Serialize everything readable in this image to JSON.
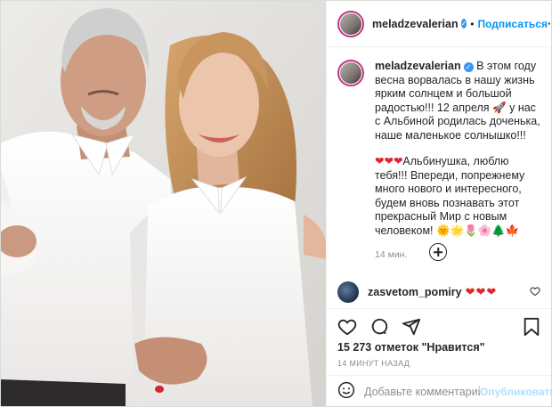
{
  "post": {
    "username": "meladzevalerian",
    "follow_label": "Подписаться",
    "more_label": "···",
    "caption": {
      "line1": "В этом году весна ворвалась в нашу жизнь ярким солнцем и большой радостью!!! 12 апреля",
      "rocket": "🚀",
      "line1b": "у нас с Альбиной родилась доченька, наше маленькое солнышко!!!",
      "hearts": "❤❤❤",
      "line2": "Альбинушка, люблю тебя!!! Впереди, попрежнему много нового и интересного, будем вновь познавать этот прекрасный Мир с новым человеком!",
      "emojis": "🌞🌟🌷🌸🌲🍁"
    },
    "time": "14 мин.",
    "comment": {
      "username": "zasvetom_pomiry",
      "text": "❤❤❤"
    },
    "likes": "15 273 отметок \"Нравится\"",
    "ago": "14 минут назад",
    "add_comment_placeholder": "Добавьте комментарий...",
    "publish_label": "Опубликовать"
  },
  "colors": {
    "accent": "#0095f6",
    "heart": "#e0262b",
    "muted": "#8e8e8e"
  },
  "icons": [
    "verified-badge",
    "add-circle-icon",
    "heart-icon",
    "comment-icon",
    "share-icon",
    "bookmark-icon",
    "emoji-icon"
  ]
}
